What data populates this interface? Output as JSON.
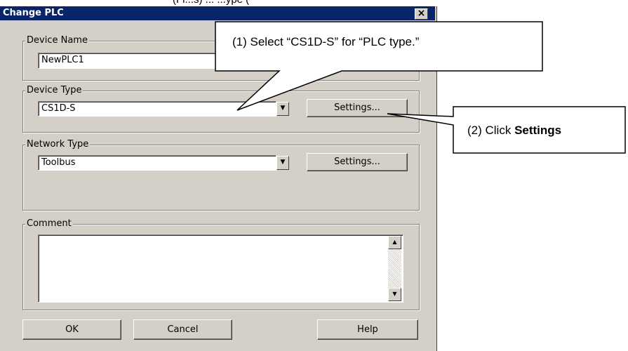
{
  "top_clip_text": "(Fl...s) ... ...ype (",
  "window": {
    "title": "Change PLC",
    "close_glyph": "×"
  },
  "device_name": {
    "legend": "Device Name",
    "value": "NewPLC1"
  },
  "device_type": {
    "legend": "Device Type",
    "value": "CS1D-S",
    "settings_label": "Settings..."
  },
  "network_type": {
    "legend": "Network Type",
    "value": "Toolbus",
    "settings_label": "Settings..."
  },
  "comment": {
    "legend": "Comment",
    "value": ""
  },
  "buttons": {
    "ok": "OK",
    "cancel": "Cancel",
    "help": "Help"
  },
  "callouts": {
    "one": "(1)  Select “CS1D-S” for “PLC type.”",
    "two_prefix": "(2) Click ",
    "two_bold": "Settings"
  }
}
